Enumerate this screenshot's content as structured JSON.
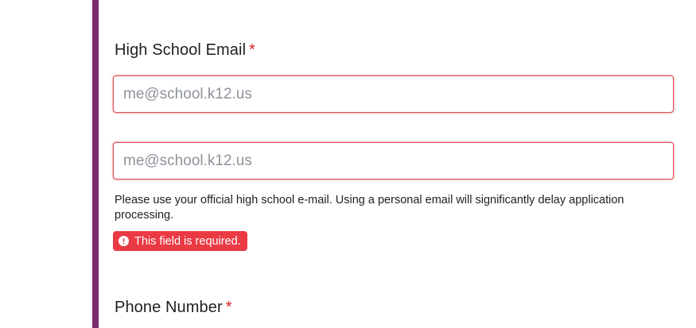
{
  "form": {
    "email_field": {
      "label": "High School Email",
      "required_marker": "*",
      "placeholder": "me@school.k12.us",
      "value": "",
      "confirm_placeholder": "me@school.k12.us",
      "confirm_value": "",
      "help_text": "Please use your official high school e-mail. Using a personal email will significantly delay application processing.",
      "error_message": "This field is required.",
      "error_icon": "exclamation-circle-icon"
    },
    "phone_field": {
      "label": "Phone Number",
      "required_marker": "*"
    }
  },
  "colors": {
    "accent_bar": "#7b2d6b",
    "required_marker": "#d8232a",
    "error_border": "#e0545a",
    "error_badge_bg": "#ea3a44",
    "placeholder": "#8d939b"
  }
}
